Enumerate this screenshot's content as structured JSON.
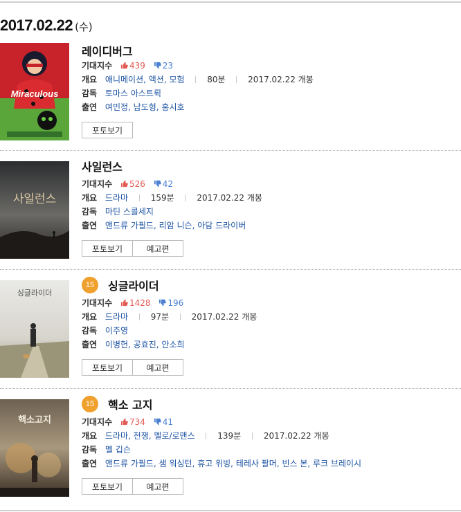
{
  "date": {
    "main": "2017.02.22",
    "day": "(수)"
  },
  "labels": {
    "expect": "기대지수",
    "summary": "개요",
    "director": "감독",
    "cast": "출연"
  },
  "movies": [
    {
      "title": "레이디버그",
      "age": "",
      "likes": "439",
      "dislikes": "23",
      "genre": "애니메이션, 액션, 모험",
      "runtime": "80분",
      "release": "2017.02.22 개봉",
      "director": "토마스 아스트뤽",
      "cast": "여민정, 남도형, 홍시호",
      "buttons": [
        "포토보기"
      ]
    },
    {
      "title": "사일런스",
      "age": "",
      "likes": "526",
      "dislikes": "42",
      "genre": "드라마",
      "runtime": "159분",
      "release": "2017.02.22 개봉",
      "director": "마틴 스콜세지",
      "cast": "앤드류 가필드, 리암 니슨, 아담 드라이버",
      "buttons": [
        "포토보기",
        "예고편"
      ]
    },
    {
      "title": "싱글라이더",
      "age": "15",
      "likes": "1428",
      "dislikes": "196",
      "genre": "드라마",
      "runtime": "97분",
      "release": "2017.02.22 개봉",
      "director": "이주영",
      "cast": "이병헌, 공효진, 안소희",
      "buttons": [
        "포토보기",
        "예고편"
      ]
    },
    {
      "title": "핵소 고지",
      "age": "15",
      "likes": "734",
      "dislikes": "41",
      "genre": "드라마, 전쟁, 멜로/로맨스",
      "runtime": "139분",
      "release": "2017.02.22 개봉",
      "director": "멜 깁슨",
      "cast": "앤드류 가필드, 샘 워싱턴, 휴고 위빙, 테레사 팔머, 빈스 본, 루크 브레이시",
      "buttons": [
        "포토보기",
        "예고편"
      ]
    }
  ],
  "colors": {
    "like": "#e25a53",
    "dislike": "#4a7fd1",
    "link": "#1e54a4",
    "age_badge": "#f0a02c"
  },
  "icons": {
    "like": "thumbs-up-icon",
    "dislike": "thumbs-down-icon"
  }
}
